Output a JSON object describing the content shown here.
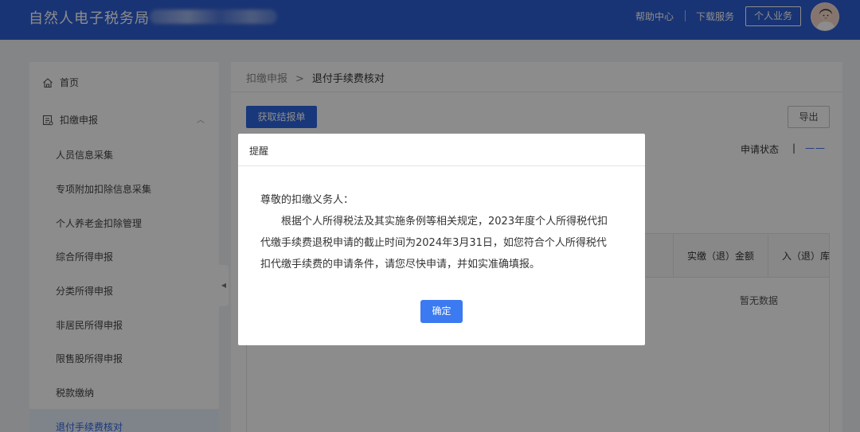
{
  "header": {
    "title": "自然人电子税务局",
    "separator": "›",
    "links": [
      "帮助中心",
      "下载服务"
    ],
    "personal_button": "个人业务",
    "brand_color": "#2f5fd4"
  },
  "sidebar": {
    "items": [
      {
        "label": "首页",
        "icon": "home-icon"
      },
      {
        "label": "扣缴申报",
        "icon": "form-icon",
        "expanded": true
      },
      {
        "label": "人员信息采集"
      },
      {
        "label": "专项附加扣除信息采集"
      },
      {
        "label": "个人养老金扣除管理"
      },
      {
        "label": "综合所得申报"
      },
      {
        "label": "分类所得申报"
      },
      {
        "label": "非居民所得申报"
      },
      {
        "label": "限售股所得申报"
      },
      {
        "label": "税款缴纳"
      },
      {
        "label": "退付手续费核对",
        "active": true
      }
    ]
  },
  "breadcrumb": {
    "parent": "扣缴申报",
    "arrow": ">",
    "current": "退付手续费核对"
  },
  "toolbar": {
    "fetch_button": "获取结报单",
    "export_button": "导出"
  },
  "filter": {
    "status_label": "申请状态",
    "status_sep": "|",
    "status_value": "——"
  },
  "table": {
    "headers": [
      "实缴（退）金额",
      "入（退）库"
    ],
    "empty_text": "暂无数据"
  },
  "dialog": {
    "title": "提醒",
    "greeting": "尊敬的扣缴义务人：",
    "lines": [
      "根据个人所得税法及其实施条例等相关规定，2023年度个人所得税代扣",
      "代缴手续费退税申请的截止时间为2024年3月31日，如您符合个人所得税代",
      "扣代缴手续费的申请条件，请您尽快申请，并如实准确填报。"
    ],
    "ok_button": "确定"
  }
}
